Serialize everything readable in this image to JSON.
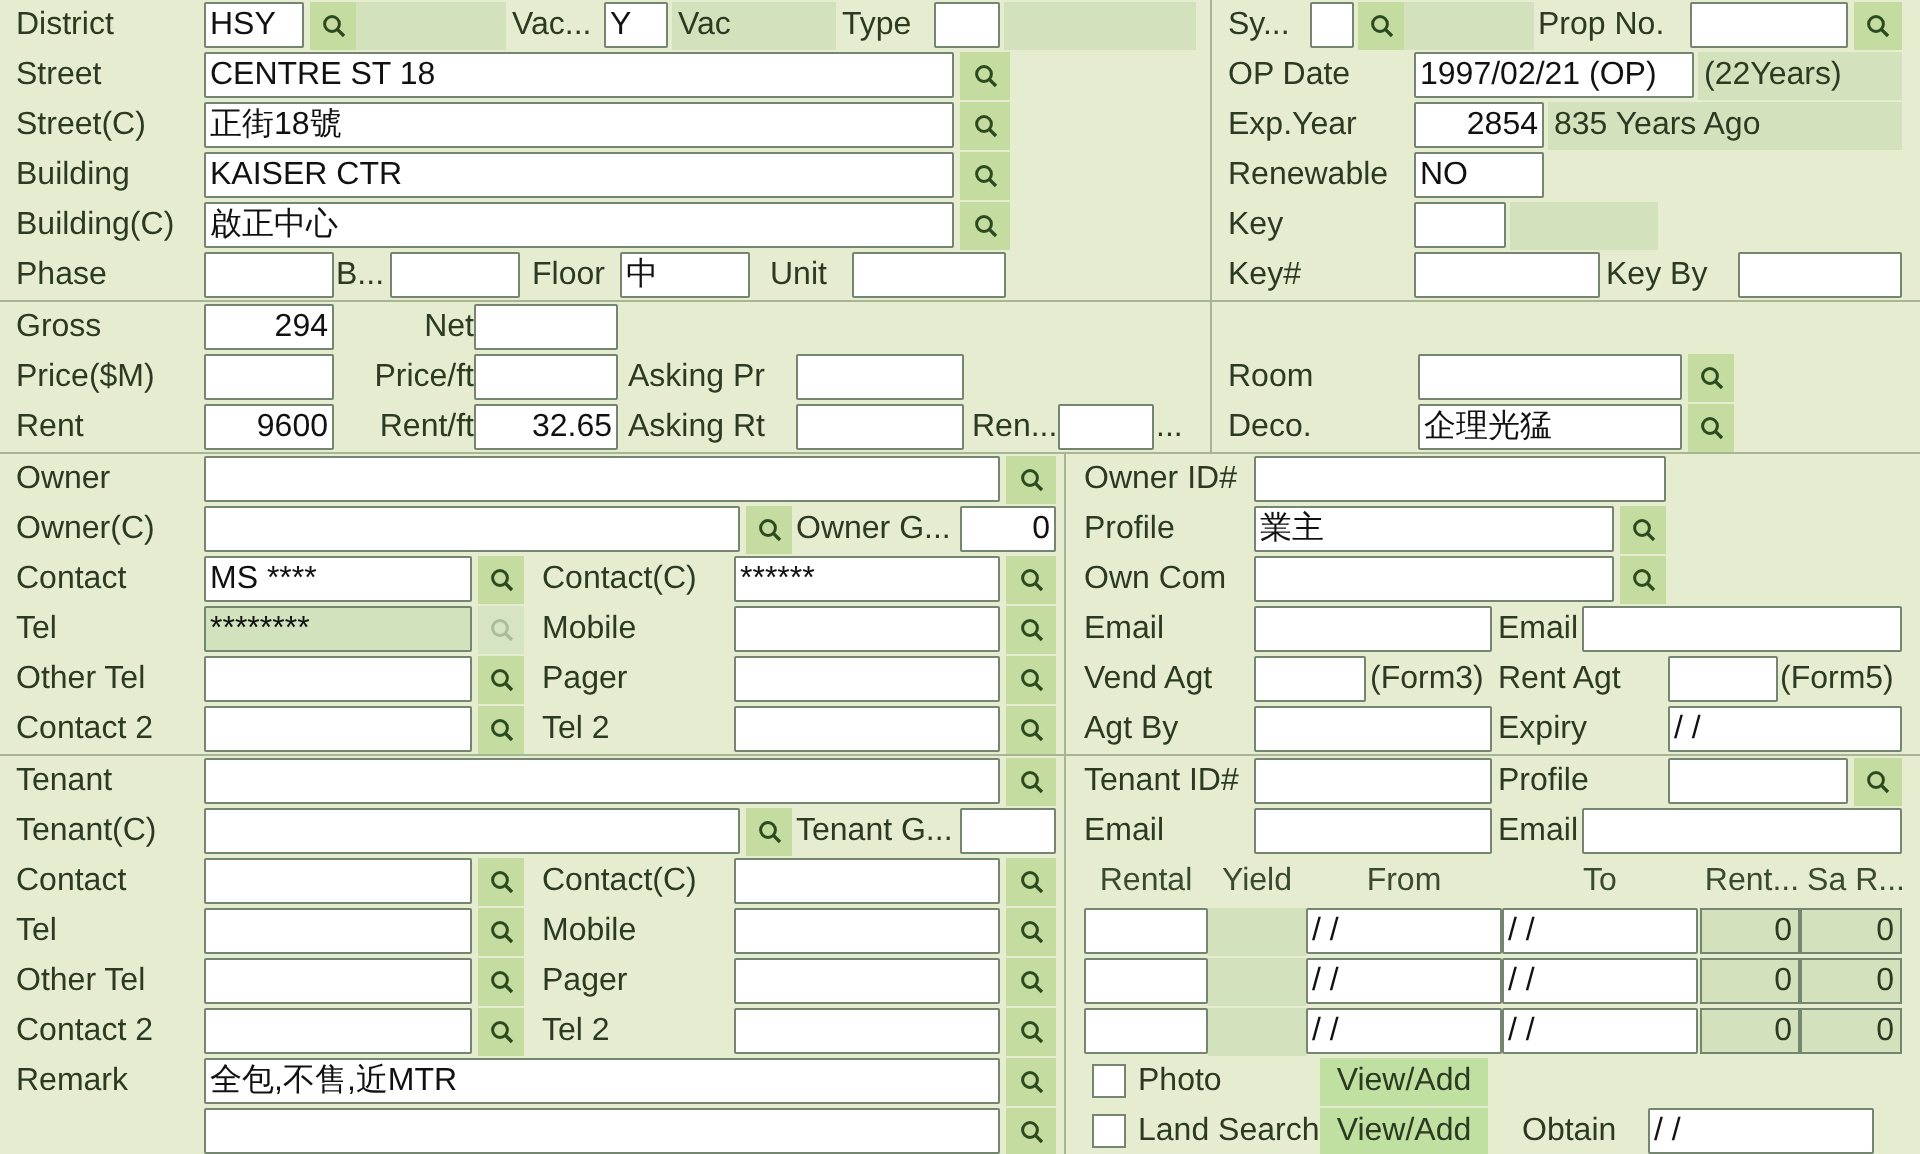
{
  "sections": [
    {
      "left": [
        [
          {
            "kind": "label",
            "text": "District"
          },
          {
            "kind": "field",
            "value": "HSY",
            "disabled": false
          },
          {
            "kind": "search",
            "disabled": false
          },
          {
            "kind": "readonly"
          },
          {
            "kind": "label",
            "text": "Vac..."
          },
          {
            "kind": "field",
            "value": "Y",
            "disabled": false
          },
          {
            "kind": "readonly",
            "value": "Vac"
          },
          {
            "kind": "label",
            "text": "Type"
          },
          {
            "kind": "field",
            "disabled": false
          },
          {
            "kind": "readonly"
          }
        ],
        [
          {
            "kind": "label",
            "text": "Street"
          },
          {
            "kind": "field",
            "value": "CENTRE ST 18",
            "disabled": false
          },
          {
            "kind": "search",
            "disabled": false
          }
        ],
        [
          {
            "kind": "label",
            "text": "Street(C)"
          },
          {
            "kind": "field",
            "value": "正街18號",
            "disabled": false
          },
          {
            "kind": "search",
            "disabled": false
          }
        ],
        [
          {
            "kind": "label",
            "text": "Building"
          },
          {
            "kind": "field",
            "value": "KAISER CTR",
            "disabled": false
          },
          {
            "kind": "search",
            "disabled": false
          }
        ],
        [
          {
            "kind": "label",
            "text": "Building(C)"
          },
          {
            "kind": "field",
            "value": "啟正中心",
            "disabled": false
          },
          {
            "kind": "search",
            "disabled": false
          }
        ],
        [
          {
            "kind": "label",
            "text": "Phase"
          },
          {
            "kind": "field",
            "disabled": false
          },
          {
            "kind": "label",
            "text": "B..."
          },
          {
            "kind": "field",
            "disabled": false
          },
          {
            "kind": "label",
            "text": "Floor"
          },
          {
            "kind": "field",
            "value": "中",
            "disabled": false
          },
          {
            "kind": "label",
            "text": "Unit"
          },
          {
            "kind": "field",
            "disabled": false
          }
        ]
      ],
      "right": [
        [
          {
            "kind": "label",
            "text": "Sy..."
          },
          {
            "kind": "field",
            "disabled": false
          },
          {
            "kind": "search",
            "disabled": false
          },
          {
            "kind": "readonly"
          },
          {
            "kind": "label",
            "text": "Prop No."
          },
          {
            "kind": "field",
            "disabled": false
          },
          {
            "kind": "search",
            "disabled": false
          }
        ],
        [
          {
            "kind": "label",
            "text": "OP Date"
          },
          {
            "kind": "field",
            "value": "1997/02/21 (OP)",
            "disabled": false
          },
          {
            "kind": "readonly",
            "value": "(22Years)"
          }
        ],
        [
          {
            "kind": "label",
            "text": "Exp.Year"
          },
          {
            "kind": "field",
            "value": "2854",
            "disabled": false
          },
          {
            "kind": "readonly",
            "value": "835 Years Ago"
          }
        ],
        [
          {
            "kind": "label",
            "text": "Renewable"
          },
          {
            "kind": "field",
            "value": "NO",
            "disabled": false
          }
        ],
        [
          {
            "kind": "label",
            "text": "Key"
          },
          {
            "kind": "field",
            "disabled": false
          },
          {
            "kind": "readonly"
          }
        ],
        [
          {
            "kind": "label",
            "text": "Key#"
          },
          {
            "kind": "field",
            "disabled": false
          },
          {
            "kind": "label",
            "text": "Key By"
          },
          {
            "kind": "field",
            "disabled": false
          }
        ]
      ]
    },
    {
      "left": [
        [
          {
            "kind": "label",
            "text": "Gross"
          },
          {
            "kind": "field",
            "value": "294",
            "disabled": false
          },
          {
            "kind": "label",
            "text": "Net"
          },
          {
            "kind": "field",
            "disabled": false
          }
        ],
        [
          {
            "kind": "label",
            "text": "Price($M)"
          },
          {
            "kind": "field",
            "disabled": false
          },
          {
            "kind": "label",
            "text": "Price/ft"
          },
          {
            "kind": "field",
            "disabled": false
          },
          {
            "kind": "label",
            "text": "Asking Pr"
          },
          {
            "kind": "field",
            "disabled": false
          }
        ],
        [
          {
            "kind": "label",
            "text": "Rent"
          },
          {
            "kind": "field",
            "value": "9600",
            "disabled": false
          },
          {
            "kind": "label",
            "text": "Rent/ft"
          },
          {
            "kind": "field",
            "value": "32.65",
            "disabled": false
          },
          {
            "kind": "label",
            "text": "Asking Rt"
          },
          {
            "kind": "field",
            "disabled": false
          },
          {
            "kind": "label",
            "text": "Ren..."
          },
          {
            "kind": "field",
            "disabled": false
          },
          {
            "kind": "label",
            "text": "..."
          }
        ]
      ],
      "right": [
        [
          {
            "kind": "label",
            "text": "Room"
          },
          {
            "kind": "field",
            "disabled": false
          },
          {
            "kind": "search",
            "disabled": false
          }
        ],
        [
          {
            "kind": "label",
            "text": "Deco."
          },
          {
            "kind": "field",
            "value": "企理光猛",
            "disabled": false
          },
          {
            "kind": "search",
            "disabled": false
          }
        ]
      ]
    },
    {
      "left": [
        [
          {
            "kind": "label",
            "text": "Owner"
          },
          {
            "kind": "field",
            "disabled": false
          },
          {
            "kind": "search",
            "disabled": false
          }
        ],
        [
          {
            "kind": "label",
            "text": "Owner(C)"
          },
          {
            "kind": "field",
            "disabled": false
          },
          {
            "kind": "search",
            "disabled": false
          },
          {
            "kind": "label",
            "text": "Owner G..."
          },
          {
            "kind": "field",
            "value": "0",
            "disabled": false
          }
        ],
        [
          {
            "kind": "label",
            "text": "Contact"
          },
          {
            "kind": "field",
            "value": "MS ****",
            "disabled": false
          },
          {
            "kind": "search",
            "disabled": false
          },
          {
            "kind": "label",
            "text": "Contact(C)"
          },
          {
            "kind": "field",
            "value": "******",
            "disabled": false
          },
          {
            "kind": "search",
            "disabled": false
          }
        ],
        [
          {
            "kind": "label",
            "text": "Tel"
          },
          {
            "kind": "field",
            "value": "********",
            "disabled": true
          },
          {
            "kind": "search",
            "disabled": true
          },
          {
            "kind": "label",
            "text": "Mobile"
          },
          {
            "kind": "field",
            "disabled": false
          },
          {
            "kind": "search",
            "disabled": false
          }
        ],
        [
          {
            "kind": "label",
            "text": "Other Tel"
          },
          {
            "kind": "field",
            "disabled": false
          },
          {
            "kind": "search",
            "disabled": false
          },
          {
            "kind": "label",
            "text": "Pager"
          },
          {
            "kind": "field",
            "disabled": false
          },
          {
            "kind": "search",
            "disabled": false
          }
        ],
        [
          {
            "kind": "label",
            "text": "Contact 2"
          },
          {
            "kind": "field",
            "disabled": false
          },
          {
            "kind": "search",
            "disabled": false
          },
          {
            "kind": "label",
            "text": "Tel 2"
          },
          {
            "kind": "field",
            "disabled": false
          },
          {
            "kind": "search",
            "disabled": false
          }
        ]
      ],
      "right": [
        [
          {
            "kind": "label",
            "text": "Owner ID#"
          },
          {
            "kind": "field",
            "disabled": false
          }
        ],
        [
          {
            "kind": "label",
            "text": "Profile"
          },
          {
            "kind": "field",
            "value": "業主",
            "disabled": false
          },
          {
            "kind": "search",
            "disabled": false
          }
        ],
        [
          {
            "kind": "label",
            "text": "Own Com"
          },
          {
            "kind": "field",
            "disabled": false
          },
          {
            "kind": "search",
            "disabled": false
          }
        ],
        [
          {
            "kind": "label",
            "text": "Email"
          },
          {
            "kind": "field",
            "disabled": false
          },
          {
            "kind": "label",
            "text": "Email"
          },
          {
            "kind": "field",
            "disabled": false
          }
        ],
        [
          {
            "kind": "label",
            "text": "Vend Agt"
          },
          {
            "kind": "field",
            "disabled": false
          },
          {
            "kind": "label",
            "text": "(Form3)"
          },
          {
            "kind": "label",
            "text": "Rent Agt"
          },
          {
            "kind": "field",
            "disabled": false
          },
          {
            "kind": "label",
            "text": "(Form5)"
          }
        ],
        [
          {
            "kind": "label",
            "text": "Agt By"
          },
          {
            "kind": "field",
            "disabled": false
          },
          {
            "kind": "label",
            "text": "Expiry"
          },
          {
            "kind": "field",
            "value": "/ /",
            "disabled": false
          }
        ]
      ]
    },
    {
      "left": [
        [
          {
            "kind": "label",
            "text": "Tenant"
          },
          {
            "kind": "field",
            "disabled": false
          },
          {
            "kind": "search",
            "disabled": false
          }
        ],
        [
          {
            "kind": "label",
            "text": "Tenant(C)"
          },
          {
            "kind": "field",
            "disabled": false
          },
          {
            "kind": "search",
            "disabled": false
          },
          {
            "kind": "label",
            "text": "Tenant G..."
          },
          {
            "kind": "field",
            "disabled": false
          }
        ],
        [
          {
            "kind": "label",
            "text": "Contact"
          },
          {
            "kind": "field",
            "disabled": false
          },
          {
            "kind": "search",
            "disabled": false
          },
          {
            "kind": "label",
            "text": "Contact(C)"
          },
          {
            "kind": "field",
            "disabled": false
          },
          {
            "kind": "search",
            "disabled": false
          }
        ],
        [
          {
            "kind": "label",
            "text": "Tel"
          },
          {
            "kind": "field",
            "disabled": false
          },
          {
            "kind": "search",
            "disabled": false
          },
          {
            "kind": "label",
            "text": "Mobile"
          },
          {
            "kind": "field",
            "disabled": false
          },
          {
            "kind": "search",
            "disabled": false
          }
        ],
        [
          {
            "kind": "label",
            "text": "Other Tel"
          },
          {
            "kind": "field",
            "disabled": false
          },
          {
            "kind": "search",
            "disabled": false
          },
          {
            "kind": "label",
            "text": "Pager"
          },
          {
            "kind": "field",
            "disabled": false
          },
          {
            "kind": "search",
            "disabled": false
          }
        ],
        [
          {
            "kind": "label",
            "text": "Contact 2"
          },
          {
            "kind": "field",
            "disabled": false
          },
          {
            "kind": "search",
            "disabled": false
          },
          {
            "kind": "label",
            "text": "Tel 2"
          },
          {
            "kind": "field",
            "disabled": false
          },
          {
            "kind": "search",
            "disabled": false
          }
        ],
        [
          {
            "kind": "label",
            "text": "Remark"
          },
          {
            "kind": "field",
            "value": "全包,不售,近MTR",
            "disabled": false
          },
          {
            "kind": "search",
            "disabled": false
          }
        ],
        [
          {
            "kind": "field",
            "disabled": false
          },
          {
            "kind": "search",
            "disabled": false
          }
        ]
      ],
      "right": [
        [
          {
            "kind": "label",
            "text": "Tenant ID#"
          },
          {
            "kind": "field",
            "disabled": false
          },
          {
            "kind": "label",
            "text": "Profile"
          },
          {
            "kind": "field",
            "disabled": false
          },
          {
            "kind": "search",
            "disabled": false
          }
        ],
        [
          {
            "kind": "label",
            "text": "Email"
          },
          {
            "kind": "field",
            "disabled": false
          },
          {
            "kind": "label",
            "text": "Email"
          },
          {
            "kind": "field",
            "disabled": false
          }
        ],
        [
          {
            "kind": "header",
            "text": "Rental"
          },
          {
            "kind": "header",
            "text": "Yield"
          },
          {
            "kind": "header",
            "text": "From"
          },
          {
            "kind": "header",
            "text": "To"
          },
          {
            "kind": "header",
            "text": "Rent..."
          },
          {
            "kind": "header",
            "text": "Sa R..."
          }
        ],
        [
          {
            "kind": "field",
            "disabled": false
          },
          {
            "kind": "readonly"
          },
          {
            "kind": "field",
            "value": "/ /",
            "disabled": false
          },
          {
            "kind": "field",
            "value": "/ /",
            "disabled": false
          },
          {
            "kind": "readonly",
            "value": "0"
          },
          {
            "kind": "readonly",
            "value": "0"
          }
        ],
        [
          {
            "kind": "field",
            "disabled": false
          },
          {
            "kind": "readonly"
          },
          {
            "kind": "field",
            "value": "/ /",
            "disabled": false
          },
          {
            "kind": "field",
            "value": "/ /",
            "disabled": false
          },
          {
            "kind": "readonly",
            "value": "0"
          },
          {
            "kind": "readonly",
            "value": "0"
          }
        ],
        [
          {
            "kind": "field",
            "disabled": false
          },
          {
            "kind": "readonly"
          },
          {
            "kind": "field",
            "value": "/ /",
            "disabled": false
          },
          {
            "kind": "field",
            "value": "/ /",
            "disabled": false
          },
          {
            "kind": "readonly",
            "value": "0"
          },
          {
            "kind": "readonly",
            "value": "0"
          }
        ],
        [
          {
            "kind": "checkbox",
            "checked": false
          },
          {
            "kind": "label",
            "text": "Photo"
          },
          {
            "kind": "button",
            "label": "View/Add"
          }
        ],
        [
          {
            "kind": "checkbox",
            "checked": false
          },
          {
            "kind": "label",
            "text": "Land Search"
          },
          {
            "kind": "button",
            "label": "View/Add"
          },
          {
            "kind": "label",
            "text": "Obtain"
          },
          {
            "kind": "field",
            "value": "/ /",
            "disabled": false
          }
        ]
      ]
    }
  ]
}
